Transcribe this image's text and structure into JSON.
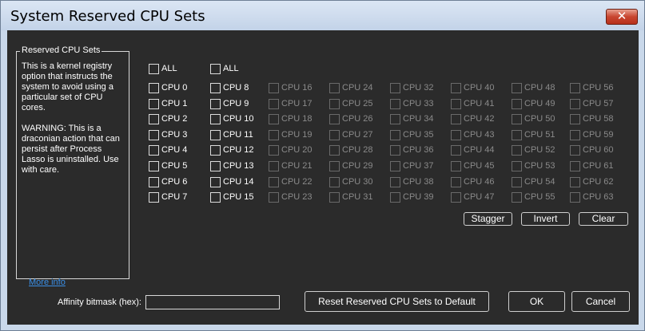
{
  "window": {
    "title": "System Reserved CPU Sets",
    "close_glyph": "✕"
  },
  "groupbox": {
    "title": "Reserved CPU Sets",
    "description": "This is a kernel registry option that instructs the system to avoid using a particular set of CPU cores.\n\nWARNING: This is a draconian action that can persist after Process Lasso is uninstalled. Use with care.",
    "more_info": "More info"
  },
  "all_label": "ALL",
  "cpu_columns": [
    [
      "CPU 0",
      "CPU 1",
      "CPU 2",
      "CPU 3",
      "CPU 4",
      "CPU 5",
      "CPU 6",
      "CPU 7"
    ],
    [
      "CPU 8",
      "CPU 9",
      "CPU 10",
      "CPU 11",
      "CPU 12",
      "CPU 13",
      "CPU 14",
      "CPU 15"
    ],
    [
      "CPU 16",
      "CPU 17",
      "CPU 18",
      "CPU 19",
      "CPU 20",
      "CPU 21",
      "CPU 22",
      "CPU 23"
    ],
    [
      "CPU 24",
      "CPU 25",
      "CPU 26",
      "CPU 27",
      "CPU 28",
      "CPU 29",
      "CPU 30",
      "CPU 31"
    ],
    [
      "CPU 32",
      "CPU 33",
      "CPU 34",
      "CPU 35",
      "CPU 36",
      "CPU 37",
      "CPU 38",
      "CPU 39"
    ],
    [
      "CPU 40",
      "CPU 41",
      "CPU 42",
      "CPU 43",
      "CPU 44",
      "CPU 45",
      "CPU 46",
      "CPU 47"
    ],
    [
      "CPU 48",
      "CPU 49",
      "CPU 50",
      "CPU 51",
      "CPU 52",
      "CPU 53",
      "CPU 54",
      "CPU 55"
    ],
    [
      "CPU 56",
      "CPU 57",
      "CPU 58",
      "CPU 59",
      "CPU 60",
      "CPU 61",
      "CPU 62",
      "CPU 63"
    ]
  ],
  "enabled_columns": [
    true,
    true,
    false,
    false,
    false,
    false,
    false,
    false
  ],
  "buttons": {
    "stagger": "Stagger",
    "invert": "Invert",
    "clear": "Clear",
    "reset": "Reset Reserved CPU Sets to Default",
    "ok": "OK",
    "cancel": "Cancel"
  },
  "bitmask": {
    "label": "Affinity bitmask (hex):",
    "value": ""
  },
  "colors": {
    "client_bg": "#2b2b2b",
    "title_bg": "#c9d8ea",
    "close_red": "#c8452f",
    "link_blue": "#3a8fe6"
  }
}
